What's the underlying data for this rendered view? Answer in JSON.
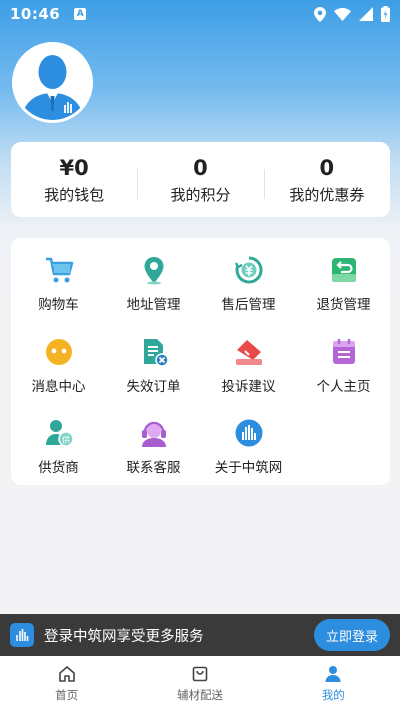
{
  "status_bar": {
    "time": "10:46",
    "notification_letter": "A"
  },
  "user": {
    "avatar_icon": "user-avatar-icon"
  },
  "stats": [
    {
      "value": "¥0",
      "label": "我的钱包"
    },
    {
      "value": "0",
      "label": "我的积分"
    },
    {
      "value": "0",
      "label": "我的优惠券"
    }
  ],
  "menu": [
    {
      "label": "购物车",
      "icon": "shopping-cart-icon",
      "color": "#3aa0e0"
    },
    {
      "label": "地址管理",
      "icon": "location-pin-icon",
      "color": "#2fa89a"
    },
    {
      "label": "售后管理",
      "icon": "after-sales-icon",
      "color": "#2fa89a"
    },
    {
      "label": "退货管理",
      "icon": "return-goods-icon",
      "color": "#2bb673"
    },
    {
      "label": "消息中心",
      "icon": "message-bubble-icon",
      "color": "#f5b323"
    },
    {
      "label": "失效订单",
      "icon": "invalid-order-icon",
      "color": "#2fa89a"
    },
    {
      "label": "投诉建议",
      "icon": "complaint-icon",
      "color": "#e84a4a"
    },
    {
      "label": "个人主页",
      "icon": "personal-page-icon",
      "color": "#b466d6"
    },
    {
      "label": "供货商",
      "icon": "supplier-icon",
      "color": "#2fa89a"
    },
    {
      "label": "联系客服",
      "icon": "customer-service-icon",
      "color": "#a75ed1"
    },
    {
      "label": "关于中筑网",
      "icon": "about-logo-icon",
      "color": "#2d8ee0"
    }
  ],
  "login_banner": {
    "text": "登录中筑网享受更多服务",
    "button": "立即登录"
  },
  "tabs": [
    {
      "label": "首页",
      "icon": "home-icon"
    },
    {
      "label": "辅材配送",
      "icon": "shopping-bag-icon"
    },
    {
      "label": "我的",
      "icon": "person-icon",
      "active": true
    }
  ],
  "colors": {
    "accent": "#2d8ee0",
    "banner_bg": "#3a3a3a"
  }
}
